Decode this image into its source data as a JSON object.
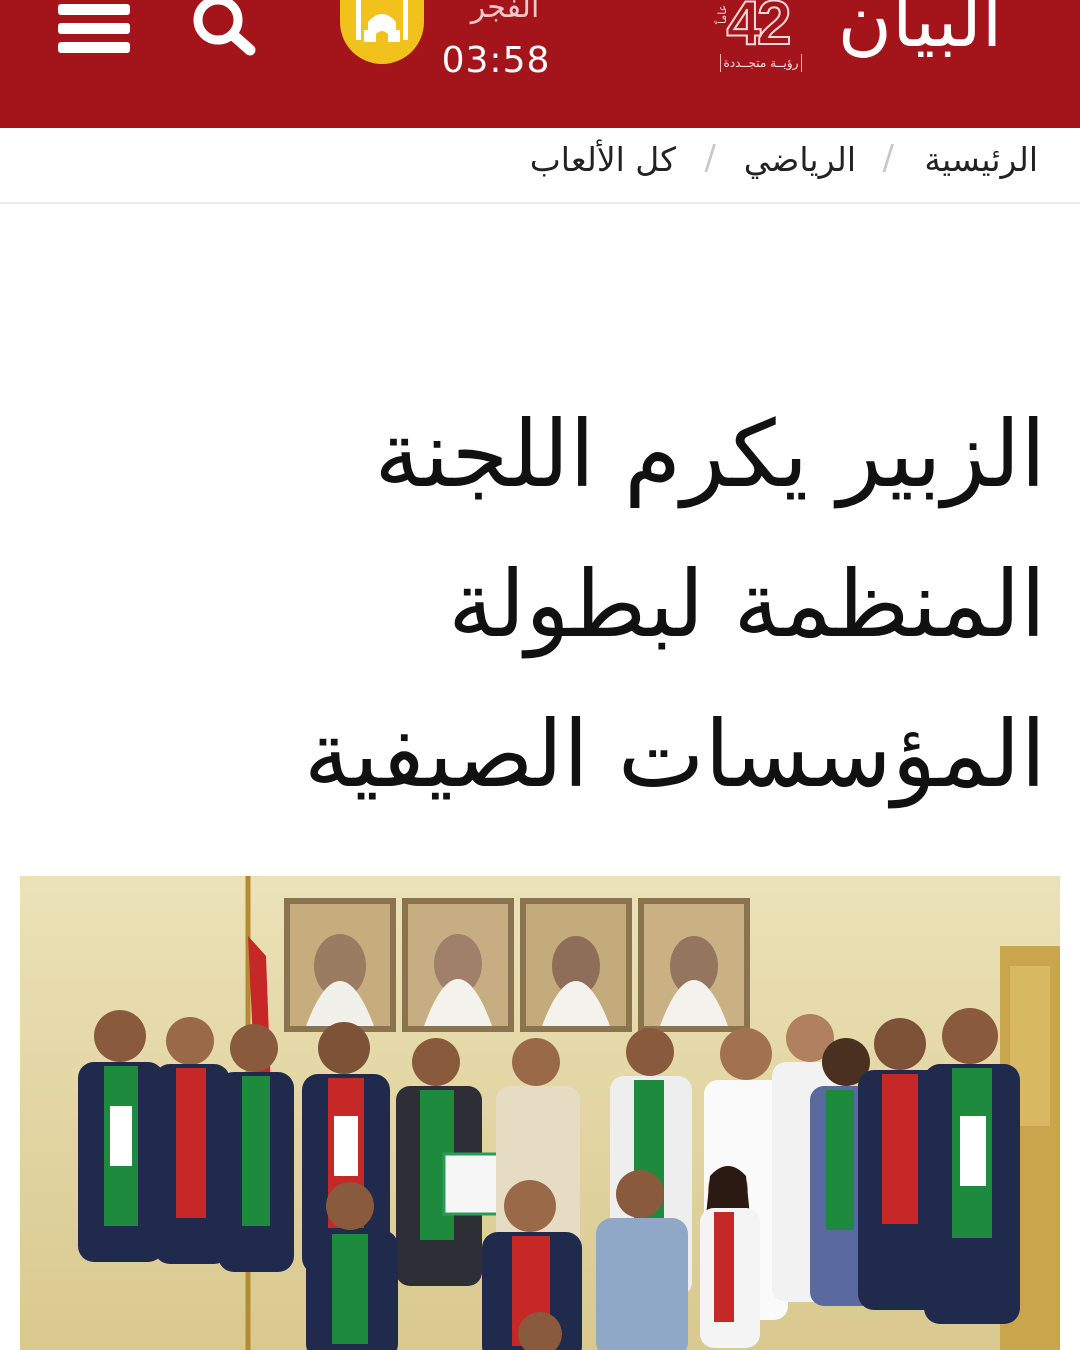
{
  "header": {
    "logo_text": "البيان",
    "anniversary_number": "42",
    "anniversary_years_label": "عاماً",
    "anniversary_slogan": "رؤيــة متجــددة",
    "prayer": {
      "name": "الفجر",
      "time": "03:58",
      "icon": "mosque-icon"
    },
    "search_icon": "search-icon",
    "menu_icon": "hamburger-menu-icon",
    "colors": {
      "brand": "#a3141b",
      "prayer_badge": "#f2c21c"
    }
  },
  "breadcrumb": {
    "items": [
      "الرئيسية",
      "الرياضي",
      "كل الألعاب"
    ],
    "separator": "/"
  },
  "article": {
    "title_lines": [
      "الزبير يكرم اللجنة",
      "المنظمة لبطولة",
      "المؤسسات الصيفية"
    ]
  }
}
